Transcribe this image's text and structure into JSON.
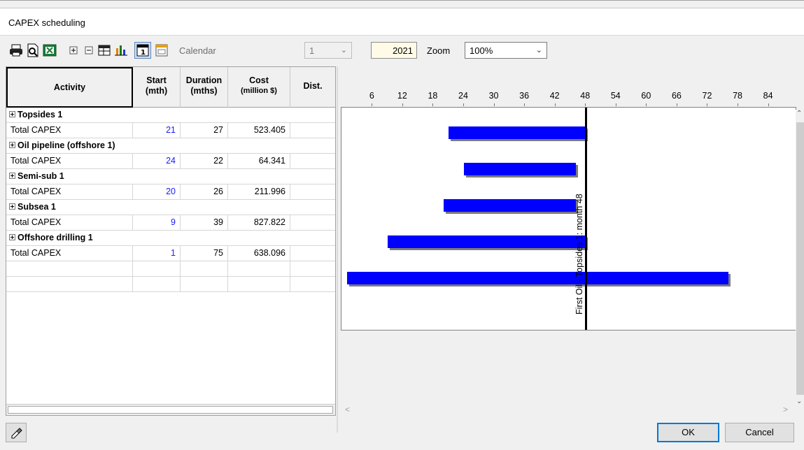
{
  "window": {
    "title": "CAPEX scheduling"
  },
  "toolbar": {
    "calendar_label": "Calendar",
    "calendar_value": "1",
    "year": "2021",
    "zoom_label": "Zoom",
    "zoom_value": "100%"
  },
  "grid": {
    "headers": {
      "activity": "Activity",
      "start_1": "Start",
      "start_2": "(mth)",
      "duration_1": "Duration",
      "duration_2": "(mths)",
      "cost_1": "Cost",
      "cost_2": "(million $)",
      "dist": "Dist."
    },
    "rows": [
      {
        "type": "group",
        "label": "Topsides 1"
      },
      {
        "type": "item",
        "label": "Total CAPEX",
        "start": "21",
        "duration": "27",
        "cost": "523.405",
        "dist": ""
      },
      {
        "type": "group",
        "label": "Oil pipeline (offshore 1)"
      },
      {
        "type": "item",
        "label": "Total CAPEX",
        "start": "24",
        "duration": "22",
        "cost": "64.341",
        "dist": ""
      },
      {
        "type": "group",
        "label": "Semi-sub 1"
      },
      {
        "type": "item",
        "label": "Total CAPEX",
        "start": "20",
        "duration": "26",
        "cost": "211.996",
        "dist": ""
      },
      {
        "type": "group",
        "label": "Subsea 1"
      },
      {
        "type": "item",
        "label": "Total CAPEX",
        "start": "9",
        "duration": "39",
        "cost": "827.822",
        "dist": ""
      },
      {
        "type": "group",
        "label": "Offshore drilling 1"
      },
      {
        "type": "item",
        "label": "Total CAPEX",
        "start": "1",
        "duration": "75",
        "cost": "638.096",
        "dist": ""
      }
    ]
  },
  "chart_data": {
    "type": "bar",
    "orientation": "horizontal-gantt",
    "x_ticks": [
      6,
      12,
      18,
      24,
      30,
      36,
      42,
      48,
      54,
      60,
      66,
      72,
      78,
      84
    ],
    "xlim": [
      1,
      84
    ],
    "bars": [
      {
        "start": 21,
        "end": 48
      },
      {
        "start": 24,
        "end": 46
      },
      {
        "start": 20,
        "end": 46
      },
      {
        "start": 9,
        "end": 48
      },
      {
        "start": 1,
        "end": 76
      }
    ],
    "bar_color": "#0000ff",
    "marker": {
      "x": 48,
      "label": "First Oil - Topsides 1: month 48"
    }
  },
  "footer": {
    "ok_label": "OK",
    "cancel_label": "Cancel"
  }
}
